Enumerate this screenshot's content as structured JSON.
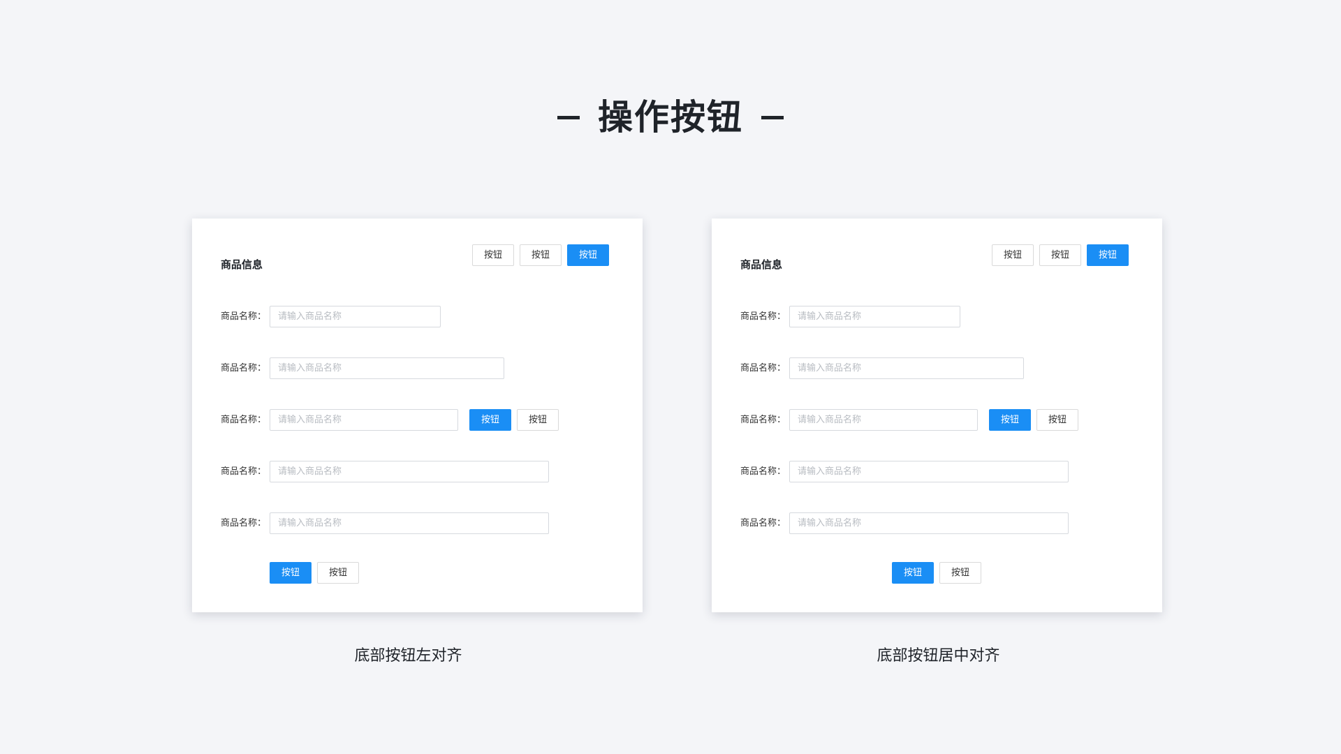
{
  "page": {
    "title": "操作按钮",
    "accent_color": "#1a8ef5",
    "background_color": "#f4f5f8"
  },
  "left_card": {
    "heading": "商品信息",
    "header_buttons": [
      "按钮",
      "按钮",
      "按钮"
    ],
    "fields": [
      {
        "label": "商品名称：",
        "placeholder": "请输入商品名称",
        "value": ""
      },
      {
        "label": "商品名称：",
        "placeholder": "请输入商品名称",
        "value": ""
      },
      {
        "label": "商品名称：",
        "placeholder": "请输入商品名称",
        "value": ""
      },
      {
        "label": "商品名称：",
        "placeholder": "请输入商品名称",
        "value": ""
      },
      {
        "label": "商品名称：",
        "placeholder": "请输入商品名称",
        "value": ""
      }
    ],
    "inline_buttons": [
      "按钮",
      "按钮"
    ],
    "footer_buttons": [
      "按钮",
      "按钮"
    ],
    "caption": "底部按钮左对齐"
  },
  "right_card": {
    "heading": "商品信息",
    "header_buttons": [
      "按钮",
      "按钮",
      "按钮"
    ],
    "fields": [
      {
        "label": "商品名称：",
        "placeholder": "请输入商品名称",
        "value": ""
      },
      {
        "label": "商品名称：",
        "placeholder": "请输入商品名称",
        "value": ""
      },
      {
        "label": "商品名称：",
        "placeholder": "请输入商品名称",
        "value": ""
      },
      {
        "label": "商品名称：",
        "placeholder": "请输入商品名称",
        "value": ""
      },
      {
        "label": "商品名称：",
        "placeholder": "请输入商品名称",
        "value": ""
      }
    ],
    "inline_buttons": [
      "按钮",
      "按钮"
    ],
    "footer_buttons": [
      "按钮",
      "按钮"
    ],
    "caption": "底部按钮居中对齐"
  }
}
